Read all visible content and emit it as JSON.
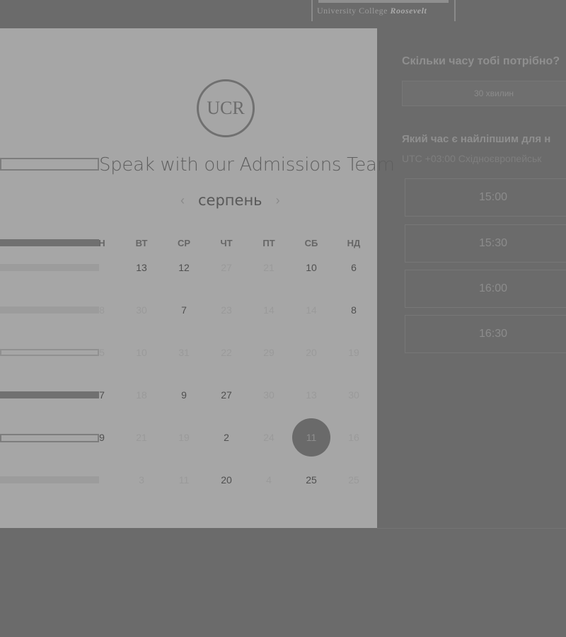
{
  "header": {
    "logo_subtitle": "University College",
    "logo_name": "Roosevelt"
  },
  "modal": {
    "logo_text": "UCR",
    "title": "Speak with our Admissions Team",
    "month": "серпень",
    "prev_icon": "chevron-left-icon",
    "next_icon": "chevron-right-icon",
    "weekdays": [
      "ВТ",
      "СР",
      "ЧТ",
      "ПТ",
      "СБ",
      "НД"
    ],
    "weekday_partial": "Н",
    "rows": [
      {
        "lead": "",
        "days": [
          {
            "t": "13",
            "on": true
          },
          {
            "t": "12",
            "on": true
          },
          {
            "t": "27",
            "on": false
          },
          {
            "t": "21",
            "on": false
          },
          {
            "t": "10",
            "on": true
          },
          {
            "t": "6",
            "on": true
          }
        ]
      },
      {
        "lead": "8",
        "days": [
          {
            "t": "30",
            "on": false
          },
          {
            "t": "7",
            "on": true
          },
          {
            "t": "23",
            "on": false
          },
          {
            "t": "14",
            "on": false
          },
          {
            "t": "14",
            "on": false
          },
          {
            "t": "8",
            "on": true
          }
        ]
      },
      {
        "lead": "5",
        "days": [
          {
            "t": "10",
            "on": false
          },
          {
            "t": "31",
            "on": false
          },
          {
            "t": "22",
            "on": false
          },
          {
            "t": "29",
            "on": false
          },
          {
            "t": "20",
            "on": false
          },
          {
            "t": "19",
            "on": false
          }
        ]
      },
      {
        "lead": "7",
        "days": [
          {
            "t": "18",
            "on": false
          },
          {
            "t": "9",
            "on": true
          },
          {
            "t": "27",
            "on": true
          },
          {
            "t": "30",
            "on": false
          },
          {
            "t": "13",
            "on": false
          },
          {
            "t": "30",
            "on": false
          }
        ]
      },
      {
        "lead": "9",
        "days": [
          {
            "t": "21",
            "on": false
          },
          {
            "t": "19",
            "on": false
          },
          {
            "t": "2",
            "on": true
          },
          {
            "t": "24",
            "on": false
          },
          {
            "t": "11",
            "on": false,
            "selected": true
          },
          {
            "t": "16",
            "on": false
          }
        ]
      },
      {
        "lead": "",
        "days": [
          {
            "t": "3",
            "on": false
          },
          {
            "t": "11",
            "on": false
          },
          {
            "t": "20",
            "on": true
          },
          {
            "t": "4",
            "on": false
          },
          {
            "t": "25",
            "on": true
          },
          {
            "t": "25",
            "on": false
          }
        ]
      }
    ]
  },
  "side": {
    "duration_question": "Скільки часу тобі потрібно?",
    "duration_value": "30 хвилин",
    "time_question": "Який час є найліпшим для н",
    "timezone": "UTC +03:00 Східноєвропейськ",
    "slots": [
      "15:00",
      "15:30",
      "16:00",
      "16:30"
    ]
  }
}
